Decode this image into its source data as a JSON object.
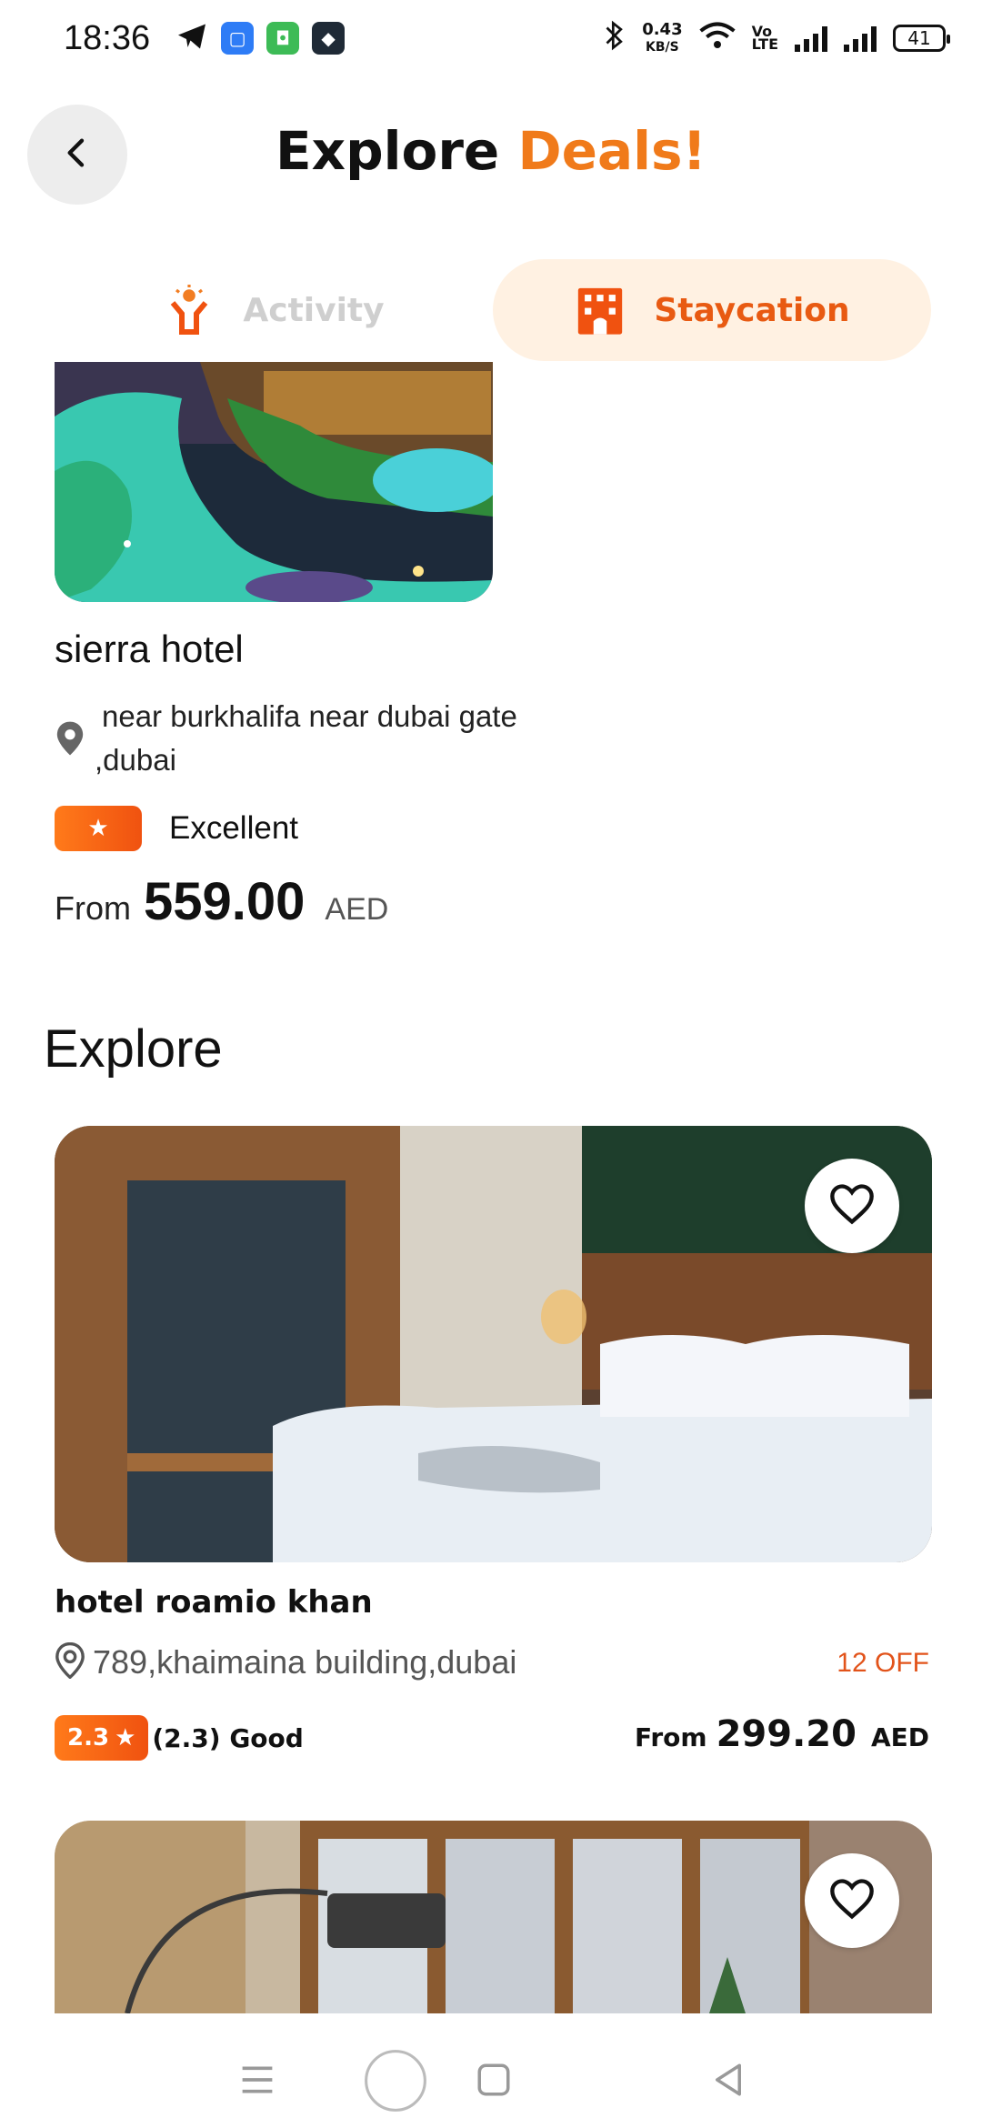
{
  "status_bar": {
    "time": "18:36",
    "net_speed_value": "0.43",
    "net_speed_unit": "KB/S",
    "volte": "Vo\nLTE",
    "battery": "41"
  },
  "header": {
    "title_part1": "Explore",
    "title_part2": "Deals!"
  },
  "tabs": [
    {
      "label": "Activity",
      "active": false
    },
    {
      "label": "Staycation",
      "active": true
    }
  ],
  "featured": {
    "name": "sierra hotel",
    "location": "near burkhalifa near dubai gate ,dubai",
    "rating_label": "Excellent",
    "price_prefix": "From",
    "price": "559.00",
    "currency": "AED"
  },
  "explore": {
    "heading": "Explore",
    "cards": [
      {
        "name": "hotel roamio khan",
        "location": "789,khaimaina building,dubai",
        "discount": "12 OFF",
        "rating": "2.3",
        "rating_text": "(2.3) Good",
        "price_prefix": "From",
        "price": "299.20",
        "currency": "AED"
      }
    ]
  },
  "colors": {
    "accent": "#f07a1a",
    "tab_active_bg": "#fff1e2",
    "badge": "#f05210"
  }
}
